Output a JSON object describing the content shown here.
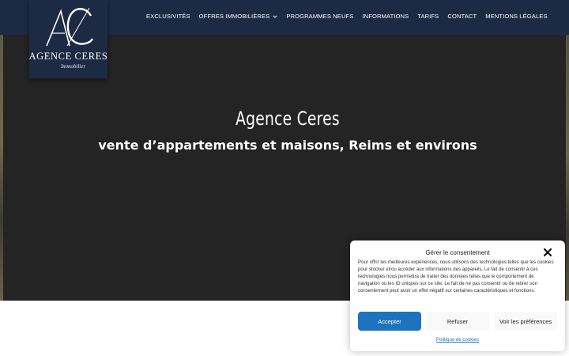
{
  "logo": {
    "title": "AGENCE CERES",
    "subtitle": "Immobilier"
  },
  "nav": {
    "items": [
      {
        "label": "EXCLUSIVITÉS"
      },
      {
        "label": "OFFRES IMMOBILIÈRES",
        "icon": "chevron-down-icon"
      },
      {
        "label": "PROGRAMMES NEUFS"
      },
      {
        "label": "INFORMATIONS"
      },
      {
        "label": "TARIFS"
      },
      {
        "label": "CONTACT"
      },
      {
        "label": "MENTIONS LÉGALES"
      }
    ]
  },
  "hero": {
    "title": "Agence Ceres",
    "subtitle": "vente d’appartements et maisons, Reims et environs"
  },
  "consent": {
    "title": "Gérer le consentement",
    "close_icon": "close-icon",
    "text": "Pour offrir les meilleures expériences, nous utilisons des technologies telles que les cookies pour stocker et/ou accéder aux informations des appareils. Le fait de consentir à ces technologies nous permettra de traiter des données telles que le comportement de navigation ou les ID uniques sur ce site. Le fait de ne pas consentir ou de retirer son consentement peut avoir un effet négatif sur certaines caractéristiques et fonctions.",
    "accept_label": "Accepter",
    "refuse_label": "Refuser",
    "prefs_label": "Voir les préférences",
    "policy_label": "Politique de cookies"
  },
  "colors": {
    "navbar": "#1c2a44",
    "hero_bg": "#242424",
    "accent": "#1e73be"
  }
}
